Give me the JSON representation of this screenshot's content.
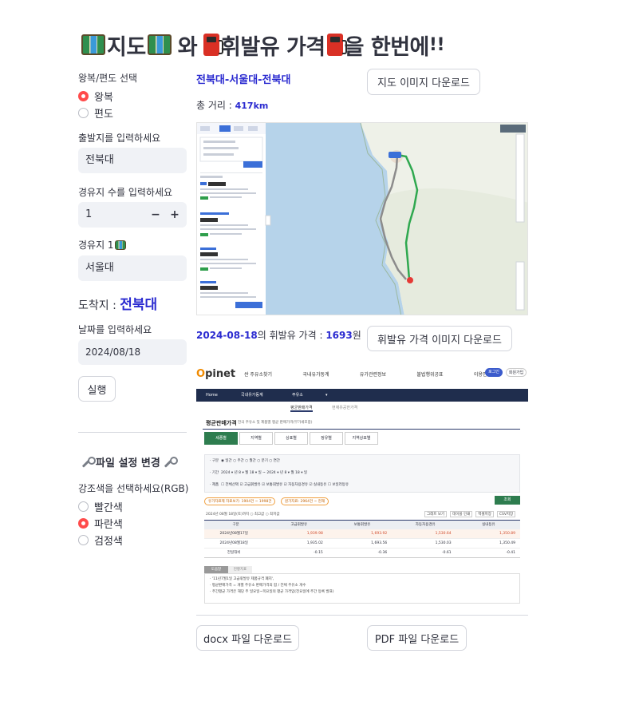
{
  "header": {
    "t1": "지도",
    "t2": "와",
    "t3": "휘발유 가격",
    "t4": "을 한번에",
    "t5": "!!"
  },
  "sidebar": {
    "trip_label": "왕복/편도 선택",
    "trip_options": [
      {
        "label": "왕복",
        "selected": true
      },
      {
        "label": "편도",
        "selected": false
      }
    ],
    "origin_label": "출발지를 입력하세요",
    "origin_value": "전북대",
    "waypoint_count_label": "경유지 수를 입력하세요",
    "waypoint_count_value": "1",
    "minus": "−",
    "plus": "+",
    "waypoint1_label": "경유지 1",
    "waypoint1_value": "서울대",
    "dest_label": "도착지 : ",
    "dest_value": "전북대",
    "date_label": "날짜를 입력하세요",
    "date_value": "2024/08/18",
    "run_label": "실행",
    "settings_title": "파일 설정 변경",
    "color_label": "강조색을 선택하세요(RGB)",
    "color_options": [
      {
        "label": "빨간색",
        "selected": false
      },
      {
        "label": "파란색",
        "selected": true
      },
      {
        "label": "검정색",
        "selected": false
      }
    ]
  },
  "main": {
    "route": "전북대-서울대-전북대",
    "map_download": "지도 이미지 다운로드",
    "dist_label": "총 거리 : ",
    "dist_value": "417km",
    "price_date": "2024-08-18",
    "price_mid": "의 휘발유 가격 : ",
    "price_value": "1693",
    "price_unit": "원",
    "price_download": "휘발유 가격 이미지 다운로드",
    "docx_download": "docx 파일 다운로드",
    "pdf_download": "PDF 파일 다운로드"
  },
  "opinet": {
    "logo_o": "O",
    "logo_rest": "pinet",
    "nav": [
      "싼 주유소찾기",
      "국내유가동계",
      "유가관련정보",
      "불법행위공표",
      "이용안내"
    ],
    "login": "로그인",
    "join": "회원가입",
    "crumb_home": "Home",
    "crumb_1": "국내유가동계",
    "crumb_2": "주유소",
    "subtab_active": "평균판매가격",
    "subtab_2": "현재유공한가격",
    "section_title": "평균판매가격",
    "section_sub": "전국 주유소 및 제품별 평균 판매가격(부가세포함)",
    "tabs": [
      "세종별",
      "지역별",
      "상표별",
      "정유별",
      "지역상표별"
    ],
    "filter_rows": [
      {
        "label": "· 구분",
        "text": "◉ 일간  ○ 주간  ○ 월간  ○ 분기  ○ 연간"
      },
      {
        "label": "· 기간",
        "text": "2024 ▾ 년  8 ▾ 월  18 ▾ 일  ~  2024 ▾ 년  8 ▾ 월  18 ▾ 일"
      },
      {
        "label": "· 제품",
        "text": "☐ 전체선택  ☑ 고급휘발유  ☑ 보통휘발유  ☑ 자동차용경유  ☑ 실내등유  ☐ 보일러등유"
      }
    ],
    "pill_1": "유가자료제 자료보기: 1904건 ~ 1998건",
    "pill_2": "원가자료: 2964건 ~ 현재",
    "search": "조회",
    "table_caption": "2024년 08월 18일(토)까지  ○ 최고값  ○ 최저값",
    "table_tools": [
      "그래프 보기",
      "테이블 인쇄",
      "엑셀저장",
      "CSV저장"
    ],
    "table_head": [
      "구분",
      "고급휘발유",
      "보통휘발유",
      "자동차용경유",
      "실내등유"
    ],
    "table_rows": [
      [
        "2024년08월17일",
        "1,939.98",
        "1,693.92",
        "1,530.64",
        "1,350.89"
      ],
      [
        "2024년08월18일",
        "1,935.02",
        "1,693.56",
        "1,530.03",
        "1,350.49"
      ],
      [
        "전일대비",
        "-0.15",
        "-0.36",
        "-0.61",
        "-0.41"
      ]
    ],
    "note_tabs": [
      "도움말",
      "현황지표"
    ],
    "notes": [
      "· '11년7월1일 고급휘발유 제품규격 폐지',",
      "· 평균판매가격 = 개별 주유소 판매가격의 합 / 전체 주유소 개수",
      "· 주간평균 가격은 해당 주 일요일~목요일의 평균 가격입(전요일에 주간 등록 발표)"
    ]
  }
}
